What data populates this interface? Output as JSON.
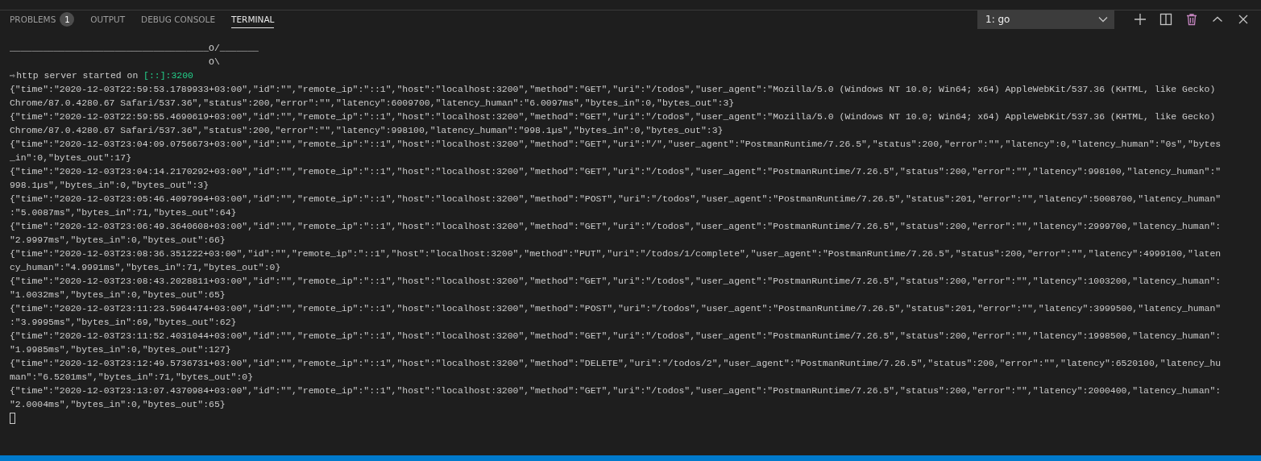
{
  "tabs": [
    {
      "label": "PROBLEMS",
      "badge": "1",
      "selected": false
    },
    {
      "label": "OUTPUT",
      "selected": false
    },
    {
      "label": "DEBUG CONSOLE",
      "selected": false
    },
    {
      "label": "TERMINAL",
      "selected": true
    }
  ],
  "terminal_selector": {
    "value": "1: go"
  },
  "toolbar": [
    {
      "kind": "add"
    },
    {
      "kind": "split"
    },
    {
      "kind": "trash"
    },
    {
      "kind": "maximize"
    },
    {
      "kind": "close"
    }
  ],
  "terminal": {
    "banner": [
      "____________________________________O/_______",
      "                                    O\\"
    ],
    "prompt": {
      "arrow": "⇨",
      "message": "http server started on",
      "address": "[::]:3200"
    },
    "log_entries": [
      "{\"time\":\"2020-12-03T22:59:53.1789933+03:00\",\"id\":\"\",\"remote_ip\":\"::1\",\"host\":\"localhost:3200\",\"method\":\"GET\",\"uri\":\"/todos\",\"user_agent\":\"Mozilla/5.0 (Windows NT 10.0; Win64; x64) AppleWebKit/537.36 (KHTML, like Gecko) Chrome/87.0.4280.67 Safari/537.36\",\"status\":200,\"error\":\"\",\"latency\":6009700,\"latency_human\":\"6.0097ms\",\"bytes_in\":0,\"bytes_out\":3}",
      "{\"time\":\"2020-12-03T22:59:55.4690619+03:00\",\"id\":\"\",\"remote_ip\":\"::1\",\"host\":\"localhost:3200\",\"method\":\"GET\",\"uri\":\"/todos\",\"user_agent\":\"Mozilla/5.0 (Windows NT 10.0; Win64; x64) AppleWebKit/537.36 (KHTML, like Gecko) Chrome/87.0.4280.67 Safari/537.36\",\"status\":200,\"error\":\"\",\"latency\":998100,\"latency_human\":\"998.1µs\",\"bytes_in\":0,\"bytes_out\":3}",
      "{\"time\":\"2020-12-03T23:04:09.0756673+03:00\",\"id\":\"\",\"remote_ip\":\"::1\",\"host\":\"localhost:3200\",\"method\":\"GET\",\"uri\":\"/\",\"user_agent\":\"PostmanRuntime/7.26.5\",\"status\":200,\"error\":\"\",\"latency\":0,\"latency_human\":\"0s\",\"bytes_in\":0,\"bytes_out\":17}",
      "{\"time\":\"2020-12-03T23:04:14.2170292+03:00\",\"id\":\"\",\"remote_ip\":\"::1\",\"host\":\"localhost:3200\",\"method\":\"GET\",\"uri\":\"/todos\",\"user_agent\":\"PostmanRuntime/7.26.5\",\"status\":200,\"error\":\"\",\"latency\":998100,\"latency_human\":\"998.1µs\",\"bytes_in\":0,\"bytes_out\":3}",
      "{\"time\":\"2020-12-03T23:05:46.4097994+03:00\",\"id\":\"\",\"remote_ip\":\"::1\",\"host\":\"localhost:3200\",\"method\":\"POST\",\"uri\":\"/todos\",\"user_agent\":\"PostmanRuntime/7.26.5\",\"status\":201,\"error\":\"\",\"latency\":5008700,\"latency_human\":\"5.0087ms\",\"bytes_in\":71,\"bytes_out\":64}",
      "{\"time\":\"2020-12-03T23:06:49.3640608+03:00\",\"id\":\"\",\"remote_ip\":\"::1\",\"host\":\"localhost:3200\",\"method\":\"GET\",\"uri\":\"/todos\",\"user_agent\":\"PostmanRuntime/7.26.5\",\"status\":200,\"error\":\"\",\"latency\":2999700,\"latency_human\":\"2.9997ms\",\"bytes_in\":0,\"bytes_out\":66}",
      "{\"time\":\"2020-12-03T23:08:36.351222+03:00\",\"id\":\"\",\"remote_ip\":\"::1\",\"host\":\"localhost:3200\",\"method\":\"PUT\",\"uri\":\"/todos/1/complete\",\"user_agent\":\"PostmanRuntime/7.26.5\",\"status\":200,\"error\":\"\",\"latency\":4999100,\"latency_human\":\"4.9991ms\",\"bytes_in\":71,\"bytes_out\":0}",
      "{\"time\":\"2020-12-03T23:08:43.2028811+03:00\",\"id\":\"\",\"remote_ip\":\"::1\",\"host\":\"localhost:3200\",\"method\":\"GET\",\"uri\":\"/todos\",\"user_agent\":\"PostmanRuntime/7.26.5\",\"status\":200,\"error\":\"\",\"latency\":1003200,\"latency_human\":\"1.0032ms\",\"bytes_in\":0,\"bytes_out\":65}",
      "{\"time\":\"2020-12-03T23:11:23.5964474+03:00\",\"id\":\"\",\"remote_ip\":\"::1\",\"host\":\"localhost:3200\",\"method\":\"POST\",\"uri\":\"/todos\",\"user_agent\":\"PostmanRuntime/7.26.5\",\"status\":201,\"error\":\"\",\"latency\":3999500,\"latency_human\":\"3.9995ms\",\"bytes_in\":69,\"bytes_out\":62}",
      "{\"time\":\"2020-12-03T23:11:52.4031044+03:00\",\"id\":\"\",\"remote_ip\":\"::1\",\"host\":\"localhost:3200\",\"method\":\"GET\",\"uri\":\"/todos\",\"user_agent\":\"PostmanRuntime/7.26.5\",\"status\":200,\"error\":\"\",\"latency\":1998500,\"latency_human\":\"1.9985ms\",\"bytes_in\":0,\"bytes_out\":127}",
      "{\"time\":\"2020-12-03T23:12:49.5736731+03:00\",\"id\":\"\",\"remote_ip\":\"::1\",\"host\":\"localhost:3200\",\"method\":\"DELETE\",\"uri\":\"/todos/2\",\"user_agent\":\"PostmanRuntime/7.26.5\",\"status\":200,\"error\":\"\",\"latency\":6520100,\"latency_human\":\"6.5201ms\",\"bytes_in\":71,\"bytes_out\":0}",
      "{\"time\":\"2020-12-03T23:13:07.4370984+03:00\",\"id\":\"\",\"remote_ip\":\"::1\",\"host\":\"localhost:3200\",\"method\":\"GET\",\"uri\":\"/todos\",\"user_agent\":\"PostmanRuntime/7.26.5\",\"status\":200,\"error\":\"\",\"latency\":2000400,\"latency_human\":\"2.0004ms\",\"bytes_in\":0,\"bytes_out\":65}"
    ]
  }
}
